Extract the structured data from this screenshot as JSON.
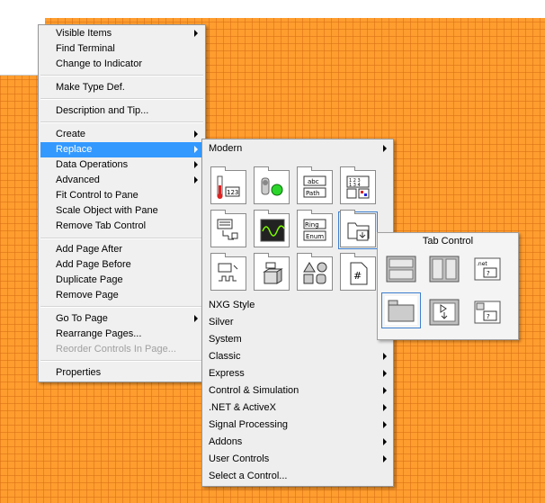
{
  "context_menu": {
    "items": [
      {
        "label": "Visible Items",
        "submenu": true
      },
      {
        "label": "Find Terminal"
      },
      {
        "label": "Change to Indicator"
      },
      {
        "label": "Make Type Def."
      },
      {
        "label": "Description and Tip..."
      },
      {
        "label": "Create",
        "submenu": true
      },
      {
        "label": "Replace",
        "submenu": true,
        "selected": true
      },
      {
        "label": "Data Operations",
        "submenu": true
      },
      {
        "label": "Advanced",
        "submenu": true
      },
      {
        "label": "Fit Control to Pane"
      },
      {
        "label": "Scale Object with Pane"
      },
      {
        "label": "Remove Tab Control"
      },
      {
        "label": "Add Page After"
      },
      {
        "label": "Add Page Before"
      },
      {
        "label": "Duplicate Page"
      },
      {
        "label": "Remove Page"
      },
      {
        "label": "Go To Page",
        "submenu": true
      },
      {
        "label": "Rearrange Pages..."
      },
      {
        "label": "Reorder Controls In Page...",
        "disabled": true
      },
      {
        "label": "Properties"
      }
    ]
  },
  "replace_submenu": {
    "header": "Modern",
    "palette_icons": [
      "numeric-icon",
      "boolean-icon",
      "string-path-icon",
      "array-cluster-icon",
      "list-table-icon",
      "graph-icon",
      "ring-enum-icon",
      "containers-icon",
      "io-icon",
      "variant-class-icon",
      "decorations-icon",
      "refnum-icon"
    ],
    "items": [
      {
        "label": "NXG Style"
      },
      {
        "label": "Silver"
      },
      {
        "label": "System"
      },
      {
        "label": "Classic",
        "submenu": true
      },
      {
        "label": "Express",
        "submenu": true
      },
      {
        "label": "Control & Simulation",
        "submenu": true
      },
      {
        "label": ".NET & ActiveX",
        "submenu": true
      },
      {
        "label": "Signal Processing",
        "submenu": true
      },
      {
        "label": "Addons",
        "submenu": true
      },
      {
        "label": "User Controls",
        "submenu": true
      },
      {
        "label": "Select a Control..."
      }
    ]
  },
  "tab_palette": {
    "title": "Tab Control",
    "icons": [
      "horizontal-splitter-icon",
      "vertical-splitter-icon",
      "dotnet-container-icon",
      "tab-control-icon",
      "subpanel-icon",
      "activex-container-icon"
    ]
  }
}
